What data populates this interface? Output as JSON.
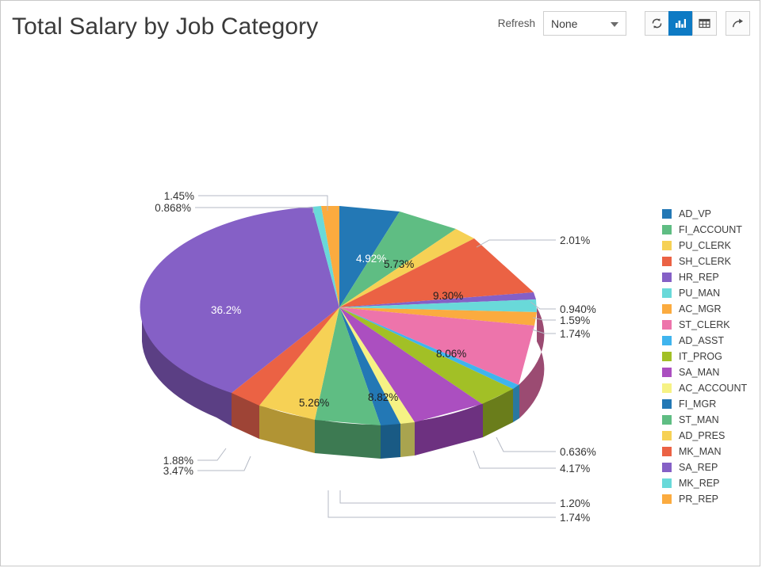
{
  "header": {
    "title": "Total Salary by Job Category",
    "refresh_label": "Refresh",
    "refresh_interval": "None",
    "refresh_options": [
      "None"
    ],
    "buttons": [
      {
        "name": "refresh-button",
        "icon": "refresh-icon",
        "active": false
      },
      {
        "name": "chart-view-button",
        "icon": "bar-chart-icon",
        "active": true
      },
      {
        "name": "table-view-button",
        "icon": "table-grid-icon",
        "active": false
      },
      {
        "name": "share-button",
        "icon": "share-arrow-icon",
        "active": false
      }
    ]
  },
  "colors": {
    "accent": "#0d7ac4",
    "border": "#c8c8c8",
    "background": "#ffffff",
    "title_text": "#3a3a3a",
    "leader_line": "#b4b9c4"
  },
  "chart_data": {
    "type": "pie",
    "title": "Total Salary by Job Category",
    "three_d": true,
    "legend_position": "right",
    "label_format": "percent",
    "categories": [
      "AD_VP",
      "FI_ACCOUNT",
      "PU_CLERK",
      "SH_CLERK",
      "HR_REP",
      "PU_MAN",
      "AC_MGR",
      "ST_CLERK",
      "AD_ASST",
      "IT_PROG",
      "SA_MAN",
      "AC_ACCOUNT",
      "FI_MGR",
      "ST_MAN",
      "AD_PRES",
      "MK_MAN",
      "SA_REP",
      "MK_REP",
      "PR_REP"
    ],
    "values": [
      4.92,
      5.73,
      2.01,
      9.3,
      0.94,
      1.59,
      1.74,
      8.06,
      0.636,
      4.17,
      8.82,
      1.2,
      1.74,
      5.26,
      3.47,
      1.88,
      36.2,
      0.868,
      1.45
    ],
    "value_labels": [
      "4.92%",
      "5.73%",
      "2.01%",
      "9.30%",
      "0.940%",
      "1.59%",
      "1.74%",
      "8.06%",
      "0.636%",
      "4.17%",
      "8.82%",
      "1.20%",
      "1.74%",
      "5.26%",
      "3.47%",
      "1.88%",
      "36.2%",
      "0.868%",
      "1.45%"
    ],
    "slice_colors": [
      "#2378b5",
      "#5fbd83",
      "#f6d155",
      "#eb6244",
      "#8560c6",
      "#69d9d9",
      "#fbab3f",
      "#ed74ab",
      "#3fb4ee",
      "#a2c026",
      "#ab4fc0",
      "#f6f284",
      "#2378b5",
      "#5fbd83",
      "#f6d155",
      "#eb6244",
      "#8560c6",
      "#69d9d9",
      "#fbab3f"
    ],
    "labels_inside": [
      "4.92%",
      "5.73%",
      "9.30%",
      "8.06%",
      "8.82%",
      "5.26%",
      "36.2%"
    ],
    "labels_outside": [
      "1.45%",
      "0.868%",
      "2.01%",
      "0.940%",
      "1.59%",
      "1.74%",
      "0.636%",
      "4.17%",
      "1.20%",
      "1.74%",
      "1.88%",
      "3.47%"
    ],
    "legend": [
      {
        "label": "AD_VP",
        "color": "#2378b5"
      },
      {
        "label": "FI_ACCOUNT",
        "color": "#5fbd83"
      },
      {
        "label": "PU_CLERK",
        "color": "#f6d155"
      },
      {
        "label": "SH_CLERK",
        "color": "#eb6244"
      },
      {
        "label": "HR_REP",
        "color": "#8560c6"
      },
      {
        "label": "PU_MAN",
        "color": "#69d9d9"
      },
      {
        "label": "AC_MGR",
        "color": "#fbab3f"
      },
      {
        "label": "ST_CLERK",
        "color": "#ed74ab"
      },
      {
        "label": "AD_ASST",
        "color": "#3fb4ee"
      },
      {
        "label": "IT_PROG",
        "color": "#a2c026"
      },
      {
        "label": "SA_MAN",
        "color": "#ab4fc0"
      },
      {
        "label": "AC_ACCOUNT",
        "color": "#f6f284"
      },
      {
        "label": "FI_MGR",
        "color": "#2378b5"
      },
      {
        "label": "ST_MAN",
        "color": "#5fbd83"
      },
      {
        "label": "AD_PRES",
        "color": "#f6d155"
      },
      {
        "label": "MK_MAN",
        "color": "#eb6244"
      },
      {
        "label": "SA_REP",
        "color": "#8560c6"
      },
      {
        "label": "MK_REP",
        "color": "#69d9d9"
      },
      {
        "label": "PR_REP",
        "color": "#fbab3f"
      }
    ]
  }
}
